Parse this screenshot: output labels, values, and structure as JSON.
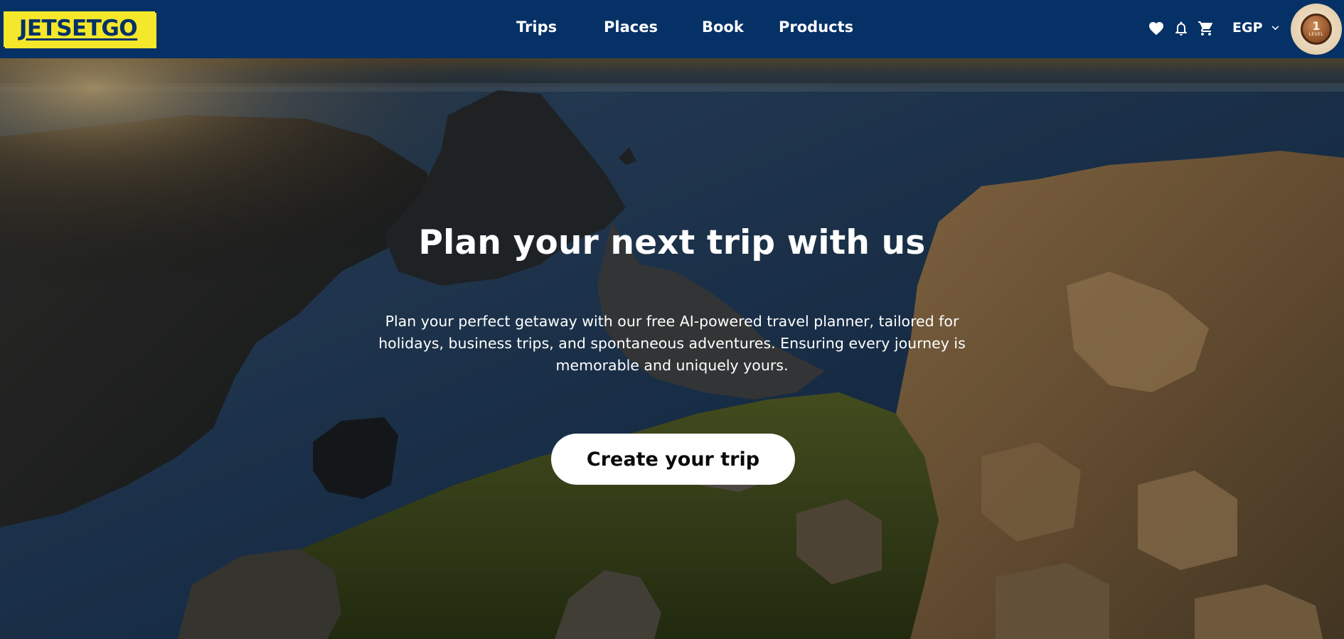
{
  "brand": {
    "logo_text": "JETSETGO"
  },
  "nav": {
    "links": [
      {
        "label": "Trips"
      },
      {
        "label": "Places"
      },
      {
        "label": "Book"
      },
      {
        "label": "Products"
      }
    ],
    "icons": [
      "heart-icon",
      "bell-icon",
      "cart-icon"
    ],
    "currency": "EGP",
    "level_badge": {
      "number": "1",
      "label": "LEVEL"
    }
  },
  "hero": {
    "title": "Plan your next trip with us",
    "description": "Plan your perfect getaway with our free AI-powered travel planner, tailored for holidays, business trips, and spontaneous adventures. Ensuring every journey is memorable and uniquely yours.",
    "cta_label": "Create your trip"
  },
  "colors": {
    "navbar_bg": "#053166",
    "logo_bg": "#f5e72a",
    "logo_text": "#053166",
    "cta_bg": "#ffffff",
    "cta_text": "#0a0a0a"
  }
}
